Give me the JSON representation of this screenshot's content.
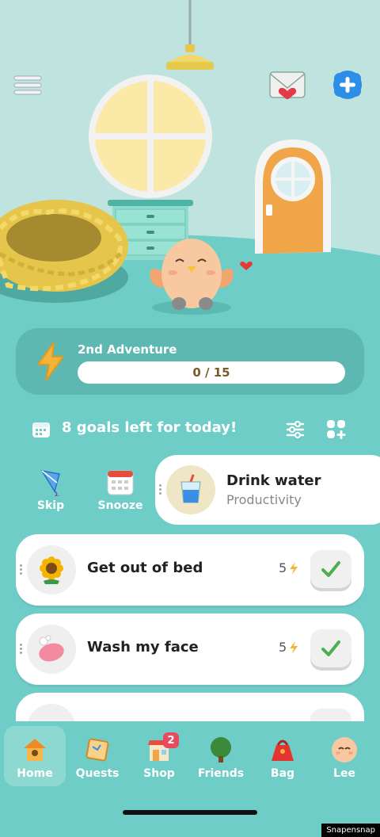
{
  "adventure": {
    "title": "2nd Adventure",
    "progress_text": "0 / 15",
    "progress": 0
  },
  "goals_header": {
    "text": "8 goals left for today!"
  },
  "swipe_actions": {
    "skip": "Skip",
    "snooze": "Snooze"
  },
  "active_goal": {
    "title": "Drink water",
    "category": "Productivity",
    "icon": "water-glass-icon"
  },
  "goals": [
    {
      "title": "Get out of bed",
      "points": "5",
      "icon": "sunflower-icon"
    },
    {
      "title": "Wash my face",
      "points": "5",
      "icon": "soap-icon"
    }
  ],
  "nav": [
    {
      "label": "Home",
      "icon": "house-icon"
    },
    {
      "label": "Quests",
      "icon": "quest-map-icon"
    },
    {
      "label": "Shop",
      "icon": "shop-icon",
      "badge": "2"
    },
    {
      "label": "Friends",
      "icon": "tree-icon"
    },
    {
      "label": "Bag",
      "icon": "bag-icon"
    },
    {
      "label": "Lee",
      "icon": "avatar-icon"
    }
  ],
  "watermark": "Snapensnap",
  "colors": {
    "teal": "#6ecdc6",
    "wall": "#bfe3df",
    "accent": "#f4b43a",
    "door": "#f0a648",
    "check": "#4caf50"
  }
}
